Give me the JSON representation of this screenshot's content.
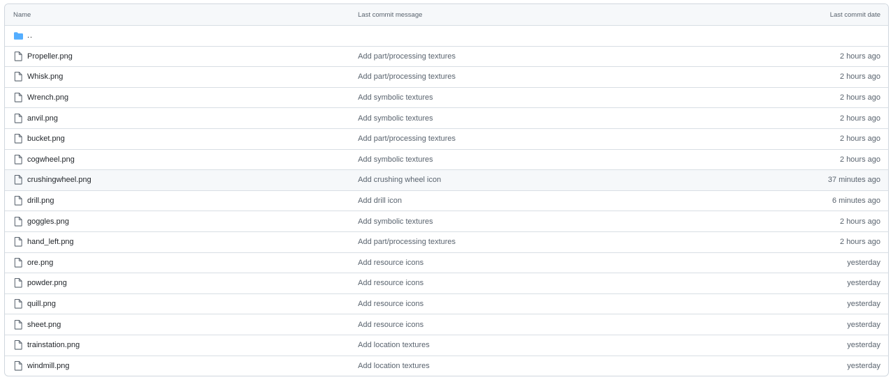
{
  "header": {
    "name": "Name",
    "message": "Last commit message",
    "date": "Last commit date"
  },
  "parent": {
    "label": "..",
    "icon": "folder-icon",
    "icon_color": "#54aeff"
  },
  "files": [
    {
      "name": "Propeller.png",
      "message": "Add part/processing textures",
      "date": "2 hours ago"
    },
    {
      "name": "Whisk.png",
      "message": "Add part/processing textures",
      "date": "2 hours ago"
    },
    {
      "name": "Wrench.png",
      "message": "Add symbolic textures",
      "date": "2 hours ago"
    },
    {
      "name": "anvil.png",
      "message": "Add symbolic textures",
      "date": "2 hours ago"
    },
    {
      "name": "bucket.png",
      "message": "Add part/processing textures",
      "date": "2 hours ago"
    },
    {
      "name": "cogwheel.png",
      "message": "Add symbolic textures",
      "date": "2 hours ago"
    },
    {
      "name": "crushingwheel.png",
      "message": "Add crushing wheel icon",
      "date": "37 minutes ago"
    },
    {
      "name": "drill.png",
      "message": "Add drill icon",
      "date": "6 minutes ago"
    },
    {
      "name": "goggles.png",
      "message": "Add symbolic textures",
      "date": "2 hours ago"
    },
    {
      "name": "hand_left.png",
      "message": "Add part/processing textures",
      "date": "2 hours ago"
    },
    {
      "name": "ore.png",
      "message": "Add resource icons",
      "date": "yesterday"
    },
    {
      "name": "powder.png",
      "message": "Add resource icons",
      "date": "yesterday"
    },
    {
      "name": "quill.png",
      "message": "Add resource icons",
      "date": "yesterday"
    },
    {
      "name": "sheet.png",
      "message": "Add resource icons",
      "date": "yesterday"
    },
    {
      "name": "trainstation.png",
      "message": "Add location textures",
      "date": "yesterday"
    },
    {
      "name": "windmill.png",
      "message": "Add location textures",
      "date": "yesterday"
    }
  ],
  "file_icon": "file-icon",
  "hovered_row": "crushingwheel.png"
}
